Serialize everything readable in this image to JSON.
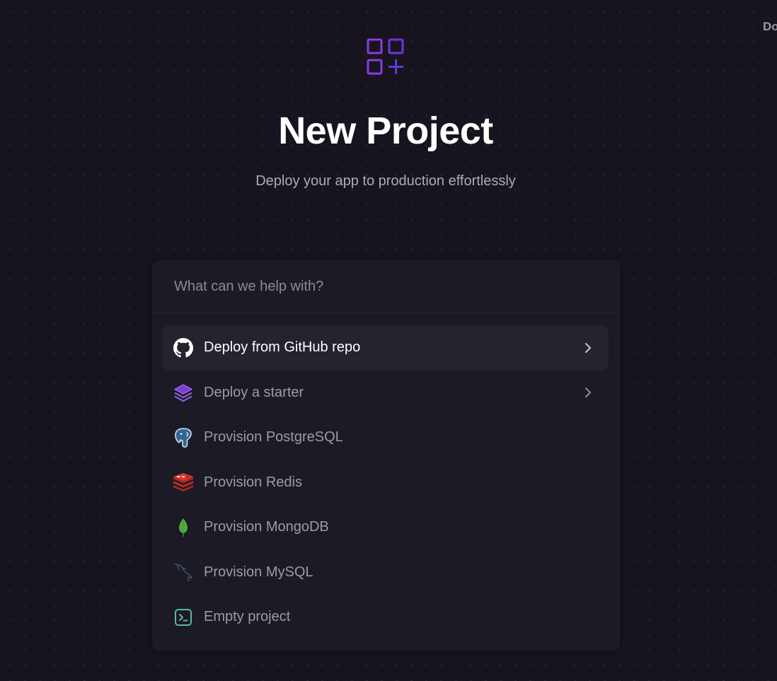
{
  "corner": {
    "label": "Docs"
  },
  "header": {
    "title": "New Project",
    "subtitle": "Deploy your app to production effortlessly"
  },
  "search": {
    "placeholder": "What can we help with?",
    "value": ""
  },
  "menu": {
    "items": [
      {
        "label": "Deploy from GitHub repo",
        "icon": "github-icon",
        "has_chevron": true,
        "active": true
      },
      {
        "label": "Deploy a starter",
        "icon": "layers-icon",
        "has_chevron": true,
        "active": false
      },
      {
        "label": "Provision PostgreSQL",
        "icon": "postgresql-icon",
        "has_chevron": false,
        "active": false
      },
      {
        "label": "Provision Redis",
        "icon": "redis-icon",
        "has_chevron": false,
        "active": false
      },
      {
        "label": "Provision MongoDB",
        "icon": "mongodb-icon",
        "has_chevron": false,
        "active": false
      },
      {
        "label": "Provision MySQL",
        "icon": "mysql-icon",
        "has_chevron": false,
        "active": false
      },
      {
        "label": "Empty project",
        "icon": "terminal-icon",
        "has_chevron": false,
        "active": false
      }
    ]
  },
  "colors": {
    "background": "#17141f",
    "panel": "#1c1a25",
    "active_item": "#26232f",
    "accent_purple": "#8a3ce0",
    "logo_plus": "#5b3bd9"
  }
}
